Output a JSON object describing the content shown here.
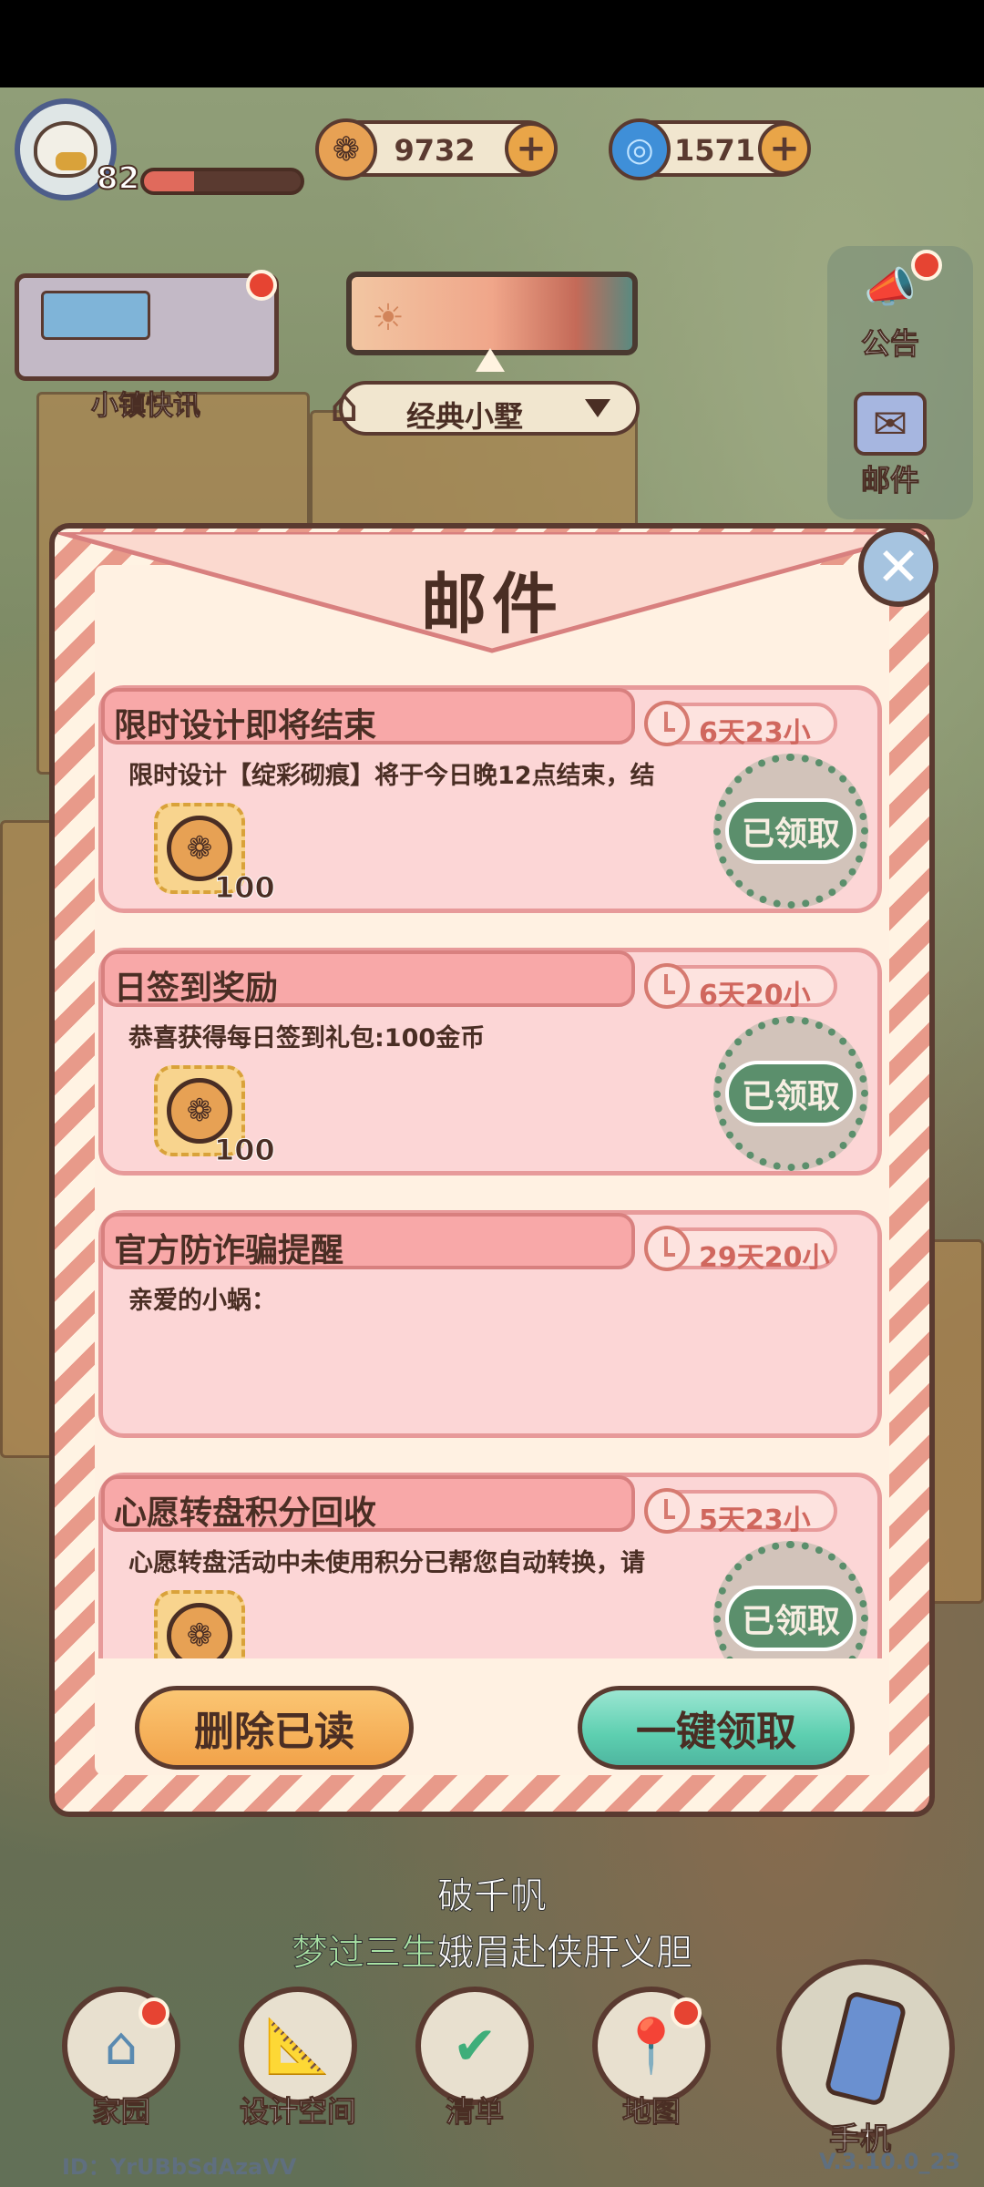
{
  "hud": {
    "level": "82",
    "xp_progress": 0.32,
    "gold": "9732",
    "gems": "1571",
    "gold_plus": "+",
    "gems_plus": "+"
  },
  "left_widget": {
    "label": "小镇快讯"
  },
  "house_selector": {
    "name": "经典小墅"
  },
  "side_menu": [
    {
      "label": "公告",
      "icon": "announcement-icon"
    },
    {
      "label": "邮件",
      "icon": "mail-icon"
    }
  ],
  "mail": {
    "title": "邮件",
    "close_symbol": "✕",
    "items": [
      {
        "title": "限时设计即将结束",
        "time": "6天23小",
        "body": "限时设计【绽彩砌痕】将于今日晚12点结束，结",
        "reward_qty": "100",
        "stamp": "已领取"
      },
      {
        "title": "日签到奖励",
        "time": "6天20小",
        "body": "恭喜获得每日签到礼包:100金币",
        "reward_qty": "100",
        "stamp": "已领取"
      },
      {
        "title": "官方防诈骗提醒",
        "time": "29天20小",
        "body": "亲爱的小蜗："
      },
      {
        "title": "心愿转盘积分回收",
        "time": "5天23小",
        "body": "心愿转盘活动中未使用积分已帮您自动转换，请",
        "stamp": "已领取"
      }
    ],
    "delete_read": "删除已读",
    "claim_all": "一键领取"
  },
  "subtitles": {
    "line1": "破千帆",
    "line2_highlight": "梦过三生",
    "line2_rest": "娥眉赴侠肝义胆"
  },
  "bottom_nav": [
    {
      "label": "家园",
      "icon": "home-icon"
    },
    {
      "label": "设计空间",
      "icon": "design-icon"
    },
    {
      "label": "清单",
      "icon": "checklist-icon"
    },
    {
      "label": "地图",
      "icon": "map-pin-icon"
    }
  ],
  "phone": {
    "label": "手机"
  },
  "footer": {
    "uid": "ID：YrUBbSdAzaVV",
    "version": "V.3.10.0_23"
  },
  "colors": {
    "accent_pink": "#f8a8a8",
    "stamp_green": "#5b8f6c",
    "claim_teal": "#5dcfb0",
    "delete_orange": "#f2a34a"
  }
}
